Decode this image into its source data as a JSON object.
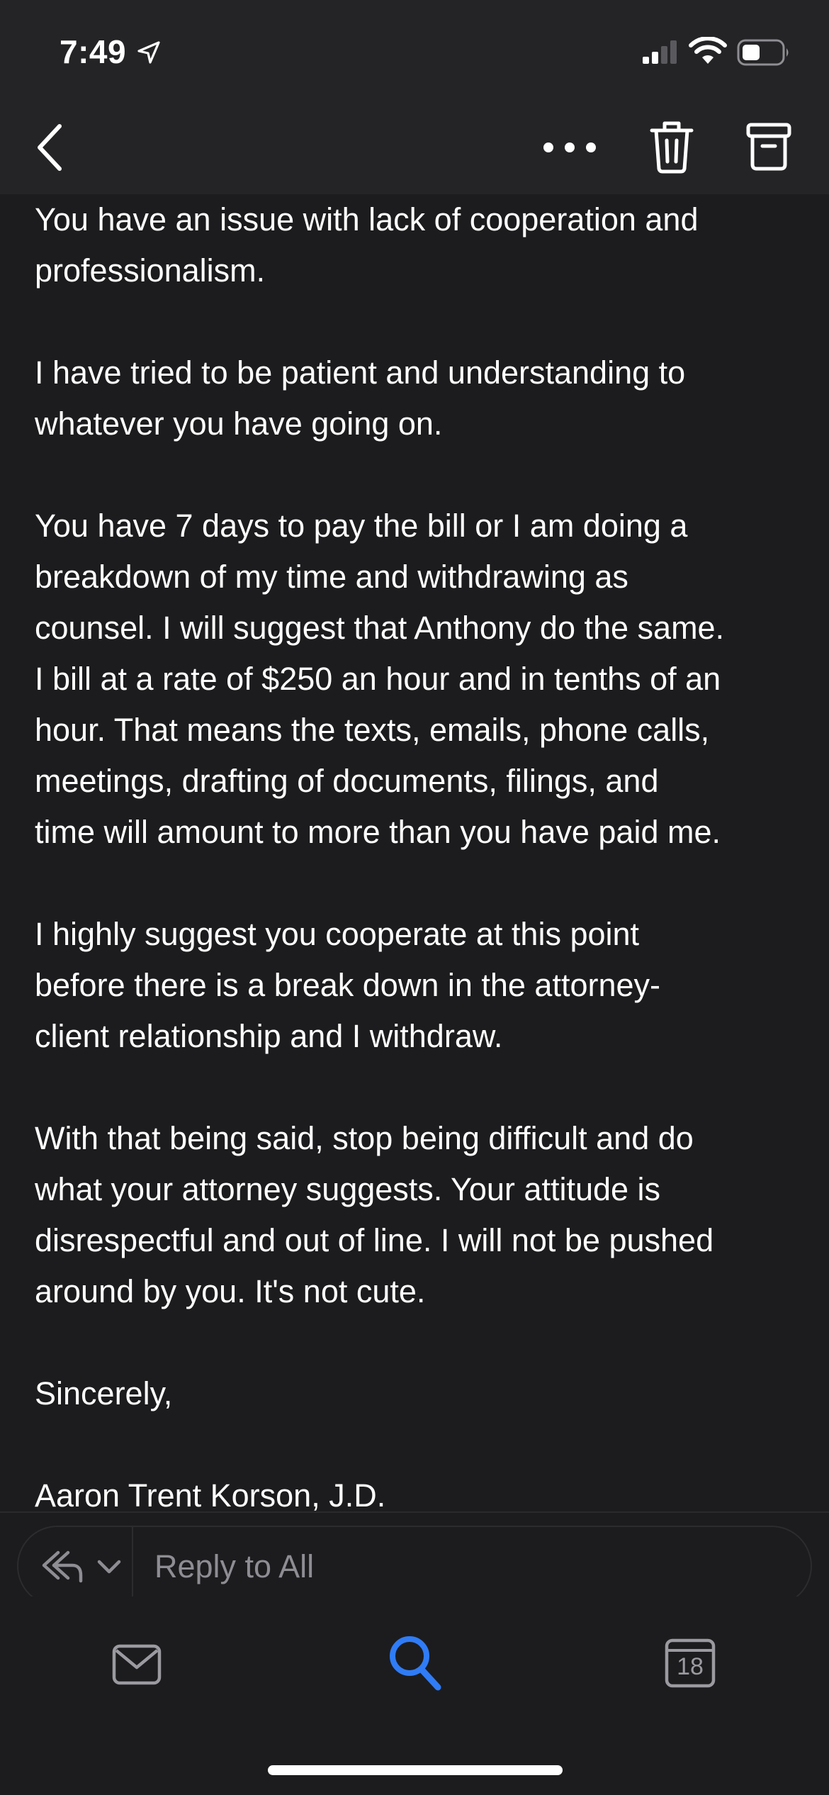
{
  "status": {
    "time": "7:49"
  },
  "nav": {
    "back_icon": "chevron-left",
    "more_icon": "ellipsis",
    "trash_icon": "trash",
    "archive_icon": "archive-box"
  },
  "email": {
    "paragraphs": [
      [
        "You have an issue with lack of cooperation and",
        "professionalism."
      ],
      [
        "I have tried to be patient and understanding to",
        "whatever you have going on."
      ],
      [
        "You have 7 days to pay the bill or I am doing a",
        "breakdown of my time and withdrawing as",
        "counsel. I will suggest that Anthony do the same.",
        "I bill at a rate of $250 an hour and in tenths of an",
        "hour. That means the texts, emails, phone calls,",
        "meetings, drafting of documents, filings, and",
        "time will amount to more than you have paid me."
      ],
      [
        "I highly suggest you cooperate at this point",
        "before there is a break down in the attorney-",
        "client relationship and I withdraw."
      ],
      [
        "With that being said, stop being difficult and do",
        "what your attorney suggests. Your attitude is",
        "disrespectful and out of line. I will not be pushed",
        "around by you. It's not cute."
      ],
      [
        "Sincerely,"
      ],
      [
        "Aaron Trent Korson, J.D."
      ]
    ]
  },
  "reply": {
    "placeholder": "Reply to All"
  },
  "tabs": {
    "mail_icon": "envelope",
    "search_icon": "magnifier",
    "calendar_day": "18"
  },
  "colors": {
    "background": "#1c1c1e",
    "chrome": "#242426",
    "accent": "#2f7cf6",
    "muted": "#8d8d93"
  }
}
